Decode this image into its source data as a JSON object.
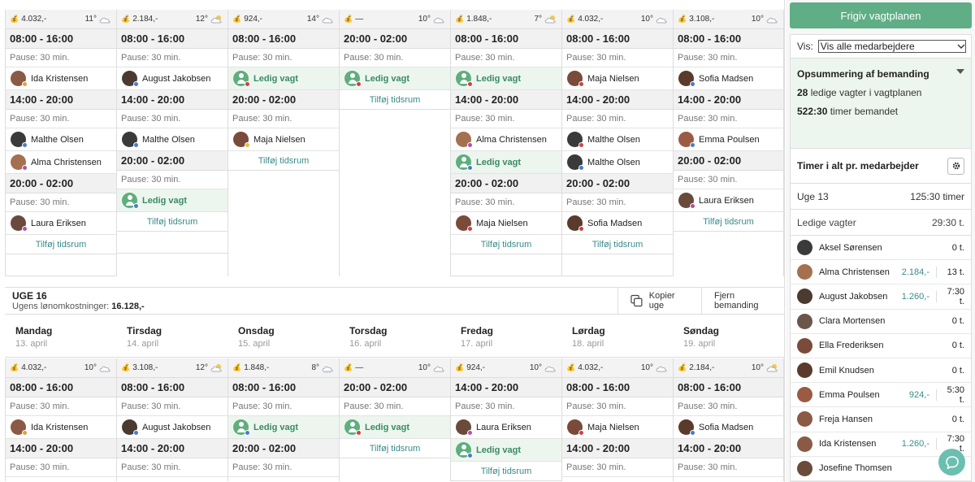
{
  "publish_label": "Frigiv vagtplanen",
  "vis_label": "Vis:",
  "vis_value": "Vis alle medarbejdere",
  "summary": {
    "title": "Opsummering af bemanding",
    "ledige_count": "28",
    "ledige_text": "ledige vagter i vagtplanen",
    "timer_count": "522:30",
    "timer_text": "timer bemandet"
  },
  "timer_title": "Timer i alt pr. medarbejder",
  "uge_label": "Uge 13",
  "uge_value": "125:30 timer",
  "ledige_label": "Ledige vagter",
  "ledige_value": "29:30 t.",
  "employees": [
    {
      "name": "Aksel Sørensen",
      "amount": "",
      "hours": "0 t."
    },
    {
      "name": "Alma Christensen",
      "amount": "2.184,-",
      "hours": "13 t."
    },
    {
      "name": "August Jakobsen",
      "amount": "1.260,-",
      "hours": "7:30 t."
    },
    {
      "name": "Clara Mortensen",
      "amount": "",
      "hours": "0 t."
    },
    {
      "name": "Ella Frederiksen",
      "amount": "",
      "hours": "0 t."
    },
    {
      "name": "Emil Knudsen",
      "amount": "",
      "hours": "0 t."
    },
    {
      "name": "Emma Poulsen",
      "amount": "924,-",
      "hours": "5:30 t."
    },
    {
      "name": "Freja Hansen",
      "amount": "",
      "hours": "0 t."
    },
    {
      "name": "Ida Kristensen",
      "amount": "1.260,-",
      "hours": "7:30 t."
    },
    {
      "name": "Josefine Thomsen",
      "amount": "",
      "hours": ""
    }
  ],
  "week16": {
    "title": "UGE 16",
    "cost_label": "Ugens lønomkostninger:",
    "cost_value": "16.128,-",
    "copy_label": "Kopier uge",
    "remove_label": "Fjern bemanding"
  },
  "day_names": [
    {
      "name": "Mandag",
      "date": "13. april"
    },
    {
      "name": "Tirsdag",
      "date": "14. april"
    },
    {
      "name": "Onsdag",
      "date": "15. april"
    },
    {
      "name": "Torsdag",
      "date": "16. april"
    },
    {
      "name": "Fredag",
      "date": "17. april"
    },
    {
      "name": "Lørdag",
      "date": "18. april"
    },
    {
      "name": "Søndag",
      "date": "19. april"
    }
  ],
  "week1": [
    {
      "cost": "4.032,-",
      "temp": "11°",
      "wx": "cloud",
      "rows": [
        {
          "t": "shift",
          "v": "08:00 - 16:00"
        },
        {
          "t": "pause",
          "v": "Pause: 30 min."
        },
        {
          "t": "emp",
          "v": "Ida Kristensen",
          "c": "#8a5a44",
          "d": "#e0a040"
        },
        {
          "t": "shift",
          "v": "14:00 - 20:00"
        },
        {
          "t": "pause",
          "v": "Pause: 30 min."
        },
        {
          "t": "emp",
          "v": "Malthe Olsen",
          "c": "#3a3a3a",
          "d": "#4a7ad0"
        },
        {
          "t": "emp",
          "v": "Alma Christensen",
          "c": "#a5704f",
          "d": "#b050b0"
        },
        {
          "t": "shift",
          "v": "20:00 - 02:00"
        },
        {
          "t": "pause",
          "v": "Pause: 30 min."
        },
        {
          "t": "emp",
          "v": "Laura Eriksen",
          "c": "#6a4a3a",
          "d": "#b050b0"
        },
        {
          "t": "add",
          "v": "Tilføj tidsrum"
        },
        {
          "t": "fill"
        }
      ]
    },
    {
      "cost": "2.184,-",
      "temp": "12°",
      "wx": "sun",
      "rows": [
        {
          "t": "shift",
          "v": "08:00 - 16:00"
        },
        {
          "t": "pause",
          "v": "Pause: 30 min."
        },
        {
          "t": "emp",
          "v": "August Jakobsen",
          "c": "#4a3a30",
          "d": "#4a7ad0"
        },
        {
          "t": "shift",
          "v": "14:00 - 20:00"
        },
        {
          "t": "pause",
          "v": "Pause: 30 min."
        },
        {
          "t": "emp",
          "v": "Malthe Olsen",
          "c": "#3a3a3a",
          "d": "#4a7ad0"
        },
        {
          "t": "shift",
          "v": "20:00 - 02:00"
        },
        {
          "t": "pause",
          "v": "Pause: 30 min."
        },
        {
          "t": "ledig",
          "v": "Ledig vagt",
          "d": "#4a7ad0"
        },
        {
          "t": "add",
          "v": "Tilføj tidsrum"
        },
        {
          "t": "fill"
        }
      ]
    },
    {
      "cost": "924,-",
      "temp": "14°",
      "wx": "cloud",
      "rows": [
        {
          "t": "shift",
          "v": "08:00 - 16:00"
        },
        {
          "t": "pause",
          "v": "Pause: 30 min."
        },
        {
          "t": "ledig",
          "v": "Ledig vagt",
          "d": "#d04040"
        },
        {
          "t": "shift",
          "v": "20:00 - 02:00"
        },
        {
          "t": "pause",
          "v": "Pause: 30 min."
        },
        {
          "t": "emp",
          "v": "Maja Nielsen",
          "c": "#7a4a3a",
          "d": "#e0c040"
        },
        {
          "t": "add",
          "v": "Tilføj tidsrum"
        }
      ]
    },
    {
      "cost": "—",
      "temp": "10°",
      "wx": "cloud",
      "rows": [
        {
          "t": "shift",
          "v": "20:00 - 02:00"
        },
        {
          "t": "pause",
          "v": "Pause: 30 min."
        },
        {
          "t": "ledig",
          "v": "Ledig vagt",
          "d": "#d04040"
        },
        {
          "t": "add",
          "v": "Tilføj tidsrum"
        }
      ]
    },
    {
      "cost": "1.848,-",
      "temp": "7°",
      "wx": "sun",
      "rows": [
        {
          "t": "shift",
          "v": "08:00 - 16:00"
        },
        {
          "t": "pause",
          "v": "Pause: 30 min."
        },
        {
          "t": "ledig",
          "v": "Ledig vagt",
          "d": "#d04040"
        },
        {
          "t": "shift",
          "v": "14:00 - 20:00"
        },
        {
          "t": "pause",
          "v": "Pause: 30 min."
        },
        {
          "t": "emp",
          "v": "Alma Christensen",
          "c": "#a5704f",
          "d": "#b050b0"
        },
        {
          "t": "ledig",
          "v": "Ledig vagt",
          "d": "#4a7ad0"
        },
        {
          "t": "shift",
          "v": "20:00 - 02:00"
        },
        {
          "t": "pause",
          "v": "Pause: 30 min."
        },
        {
          "t": "emp",
          "v": "Maja Nielsen",
          "c": "#7a4a3a",
          "d": "#d04040"
        },
        {
          "t": "add",
          "v": "Tilføj tidsrum"
        },
        {
          "t": "fill"
        }
      ]
    },
    {
      "cost": "4.032,-",
      "temp": "10°",
      "wx": "cloud",
      "rows": [
        {
          "t": "shift",
          "v": "08:00 - 16:00"
        },
        {
          "t": "pause",
          "v": "Pause: 30 min."
        },
        {
          "t": "emp",
          "v": "Maja Nielsen",
          "c": "#7a4a3a",
          "d": "#d04040"
        },
        {
          "t": "shift",
          "v": "14:00 - 20:00"
        },
        {
          "t": "pause",
          "v": "Pause: 30 min."
        },
        {
          "t": "emp",
          "v": "Malthe Olsen",
          "c": "#3a3a3a",
          "d": "#d04040"
        },
        {
          "t": "emp",
          "v": "Malthe Olsen",
          "c": "#3a3a3a",
          "d": "#4a7ad0"
        },
        {
          "t": "shift",
          "v": "20:00 - 02:00"
        },
        {
          "t": "pause",
          "v": "Pause: 30 min."
        },
        {
          "t": "emp",
          "v": "Sofia Madsen",
          "c": "#5a3a2a",
          "d": "#d04040"
        },
        {
          "t": "add",
          "v": "Tilføj tidsrum"
        },
        {
          "t": "fill"
        }
      ]
    },
    {
      "cost": "3.108,-",
      "temp": "10°",
      "wx": "cloud",
      "rows": [
        {
          "t": "shift",
          "v": "08:00 - 16:00"
        },
        {
          "t": "pause",
          "v": "Pause: 30 min."
        },
        {
          "t": "emp",
          "v": "Sofia Madsen",
          "c": "#5a3a2a",
          "d": "#4a7ad0"
        },
        {
          "t": "shift",
          "v": "14:00 - 20:00"
        },
        {
          "t": "pause",
          "v": "Pause: 30 min."
        },
        {
          "t": "emp",
          "v": "Emma Poulsen",
          "c": "#9a5a44",
          "d": "#4a7ad0"
        },
        {
          "t": "shift",
          "v": "20:00 - 02:00"
        },
        {
          "t": "pause",
          "v": "Pause: 30 min."
        },
        {
          "t": "emp",
          "v": "Laura Eriksen",
          "c": "#6a4a3a",
          "d": "#b050b0"
        },
        {
          "t": "add",
          "v": "Tilføj tidsrum"
        }
      ]
    }
  ],
  "week2": [
    {
      "cost": "4.032,-",
      "temp": "10°",
      "wx": "cloud",
      "rows": [
        {
          "t": "shift",
          "v": "08:00 - 16:00"
        },
        {
          "t": "pause",
          "v": "Pause: 30 min."
        },
        {
          "t": "emp",
          "v": "Ida Kristensen",
          "c": "#8a5a44",
          "d": "#e0a040"
        },
        {
          "t": "shift",
          "v": "14:00 - 20:00"
        },
        {
          "t": "pause",
          "v": "Pause: 30 min."
        }
      ]
    },
    {
      "cost": "3.108,-",
      "temp": "12°",
      "wx": "sun",
      "rows": [
        {
          "t": "shift",
          "v": "08:00 - 16:00"
        },
        {
          "t": "pause",
          "v": "Pause: 30 min."
        },
        {
          "t": "emp",
          "v": "August Jakobsen",
          "c": "#4a3a30",
          "d": "#4a7ad0"
        },
        {
          "t": "shift",
          "v": "14:00 - 20:00"
        },
        {
          "t": "pause",
          "v": "Pause: 30 min."
        }
      ]
    },
    {
      "cost": "1.848,-",
      "temp": "8°",
      "wx": "rain",
      "rows": [
        {
          "t": "shift",
          "v": "08:00 - 16:00"
        },
        {
          "t": "pause",
          "v": "Pause: 30 min."
        },
        {
          "t": "ledig",
          "v": "Ledig vagt",
          "d": "#4a7ad0"
        },
        {
          "t": "shift",
          "v": "20:00 - 02:00"
        },
        {
          "t": "pause",
          "v": "Pause: 30 min."
        }
      ]
    },
    {
      "cost": "—",
      "temp": "10°",
      "wx": "cloud",
      "rows": [
        {
          "t": "shift",
          "v": "20:00 - 02:00"
        },
        {
          "t": "pause",
          "v": "Pause: 30 min."
        },
        {
          "t": "ledig",
          "v": "Ledig vagt",
          "d": "#d04040"
        },
        {
          "t": "add",
          "v": "Tilføj tidsrum"
        }
      ]
    },
    {
      "cost": "924,-",
      "temp": "10°",
      "wx": "cloud",
      "rows": [
        {
          "t": "shift",
          "v": "14:00 - 20:00"
        },
        {
          "t": "pause",
          "v": "Pause: 30 min."
        },
        {
          "t": "emp",
          "v": "Laura Eriksen",
          "c": "#6a4a3a",
          "d": "#b050b0"
        },
        {
          "t": "ledig",
          "v": "Ledig vagt",
          "d": "#4a7ad0"
        },
        {
          "t": "add",
          "v": "Tilføj tidsrum"
        }
      ]
    },
    {
      "cost": "4.032,-",
      "temp": "10°",
      "wx": "cloud",
      "rows": [
        {
          "t": "shift",
          "v": "08:00 - 16:00"
        },
        {
          "t": "pause",
          "v": "Pause: 30 min."
        },
        {
          "t": "emp",
          "v": "Maja Nielsen",
          "c": "#7a4a3a",
          "d": "#d04040"
        },
        {
          "t": "shift",
          "v": "14:00 - 20:00"
        },
        {
          "t": "pause",
          "v": "Pause: 30 min."
        }
      ]
    },
    {
      "cost": "2.184,-",
      "temp": "10°",
      "wx": "sun",
      "rows": [
        {
          "t": "shift",
          "v": "08:00 - 16:00"
        },
        {
          "t": "pause",
          "v": "Pause: 30 min."
        },
        {
          "t": "emp",
          "v": "Sofia Madsen",
          "c": "#5a3a2a",
          "d": "#4a7ad0"
        },
        {
          "t": "shift",
          "v": "14:00 - 20:00"
        },
        {
          "t": "pause",
          "v": "Pause: 30 min."
        }
      ]
    }
  ]
}
